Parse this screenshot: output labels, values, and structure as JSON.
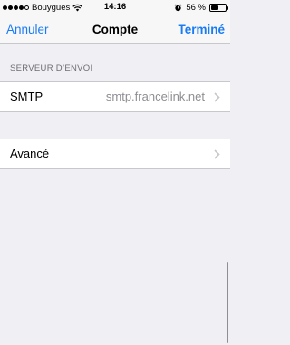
{
  "status_bar": {
    "carrier": "Bouygues",
    "time": "14:16",
    "battery_text": "56 %",
    "battery_level": 0.56,
    "signal_bars_filled": 4,
    "signal_bars_total": 5,
    "icons": [
      "signal-icon",
      "wifi-icon",
      "alarm-icon",
      "battery-icon"
    ]
  },
  "nav": {
    "cancel_label": "Annuler",
    "title": "Compte",
    "done_label": "Terminé"
  },
  "outgoing": {
    "header": "SERVEUR D’ENVOI",
    "smtp_label": "SMTP",
    "smtp_value": "smtp.francelink.net"
  },
  "advanced": {
    "label": "Avancé"
  },
  "colors": {
    "accent": "#1a7cf5",
    "background": "#efeff4",
    "secondary_text": "#8e8e93",
    "separator": "#c8c7cc"
  }
}
